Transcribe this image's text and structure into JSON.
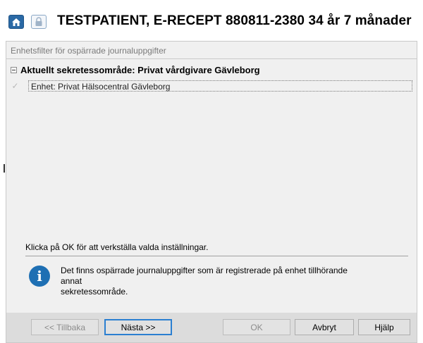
{
  "header": {
    "title": "TESTPATIENT, E-RECEPT  880811-2380  34 år 7 månader",
    "home_icon": "home-icon",
    "lock_icon": "lock-icon",
    "accent": "#2a69a5"
  },
  "panel": {
    "title": "Enhetsfilter för ospärrade journaluppgifter",
    "group_label": "Aktuellt sekretessområde: Privat vårdgivare Gävleborg",
    "item_label": "Enhet: Privat Hälsocentral Gävleborg",
    "item_checked": true
  },
  "instruction": "Klicka på OK för att verkställa valda inställningar.",
  "info": {
    "icon": "info-icon",
    "lines": [
      "Det finns ospärrade journaluppgifter som är registrerade på enhet tillhörande",
      "annat",
      "sekretessområde."
    ]
  },
  "buttons": {
    "back": "<< Tillbaka",
    "next": "Nästa >>",
    "ok": "OK",
    "cancel": "Avbryt",
    "help": "Hjälp"
  }
}
